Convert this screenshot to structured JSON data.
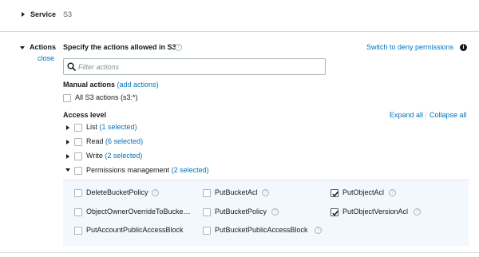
{
  "service": {
    "label": "Service",
    "value": "S3"
  },
  "actions": {
    "label": "Actions",
    "close_label": "close",
    "heading": "Specify the actions allowed in S3",
    "switch_label": "Switch to deny permissions",
    "search_placeholder": "Filter actions",
    "manual": {
      "label": "Manual actions",
      "add_open": "(",
      "add_link": "add actions",
      "add_close": ")",
      "all_label": "All S3 actions (s3:*)"
    },
    "access_level": {
      "label": "Access level",
      "expand_all": "Expand all",
      "collapse_all": "Collapse all",
      "groups": [
        {
          "name": "List",
          "count_link": "1 selected",
          "open": "(",
          "close": ")"
        },
        {
          "name": "Read",
          "count_link": "6 selected",
          "open": "(",
          "close": ")"
        },
        {
          "name": "Write",
          "count_link": "2 selected",
          "open": "(",
          "close": ")"
        },
        {
          "name": "Permissions management",
          "count_link": "2 selected",
          "open": "(",
          "close": ")"
        }
      ]
    },
    "permissions": [
      {
        "label": "DeleteBucketPolicy",
        "checked": false
      },
      {
        "label": "PutBucketAcl",
        "checked": false
      },
      {
        "label": "PutObjectAcl",
        "checked": true
      },
      {
        "label": "ObjectOwnerOverrideToBucke…",
        "checked": false
      },
      {
        "label": "PutBucketPolicy",
        "checked": false
      },
      {
        "label": "PutObjectVersionAcl",
        "checked": true
      },
      {
        "label": "PutAccountPublicAccessBlock",
        "checked": false
      },
      {
        "label": "PutBucketPublicAccessBlock",
        "checked": false
      }
    ]
  }
}
